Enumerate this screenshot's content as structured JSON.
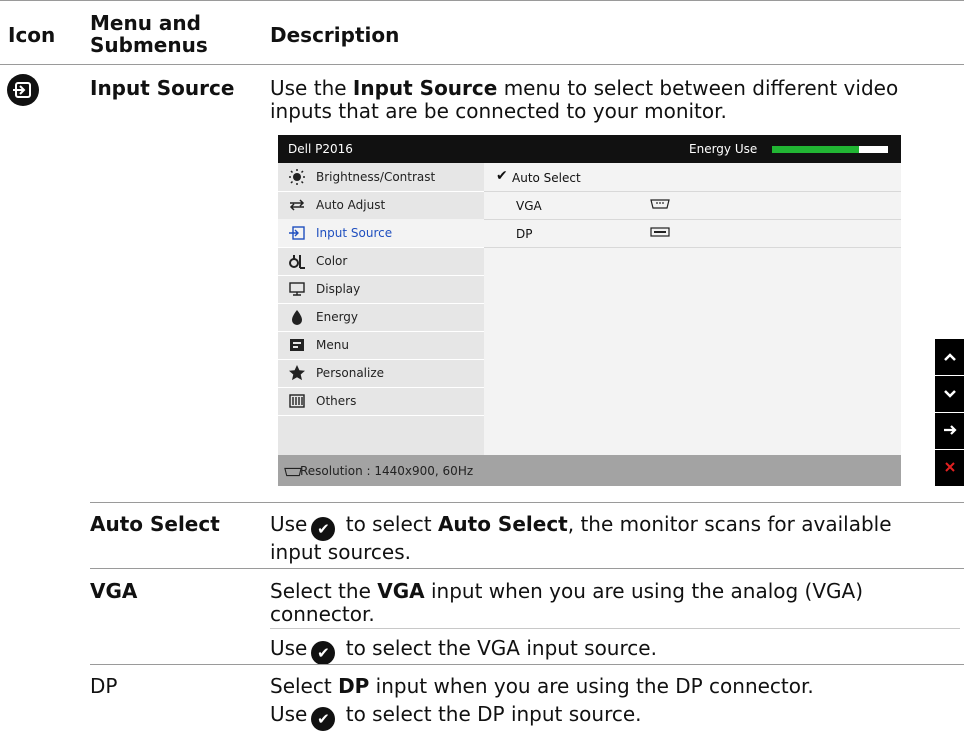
{
  "header": {
    "col_icon": "Icon",
    "col_menu_line1": "Menu and",
    "col_menu_line2": "Submenus",
    "col_desc": "Description"
  },
  "input_source": {
    "name": "Input Source",
    "desc_pre": "Use the ",
    "desc_bold": "Input Source",
    "desc_post": " menu to select between different video",
    "desc_line2": "inputs that are be connected to your monitor."
  },
  "osd": {
    "model": "Dell P2016",
    "energy_label": "Energy Use",
    "energy_level": 0.75,
    "menu_items": [
      {
        "label": "Brightness/Contrast",
        "icon": "brightness-icon"
      },
      {
        "label": "Auto Adjust",
        "icon": "auto-adjust-icon"
      },
      {
        "label": "Input Source",
        "icon": "input-source-icon"
      },
      {
        "label": "Color",
        "icon": "color-icon"
      },
      {
        "label": "Display",
        "icon": "display-icon"
      },
      {
        "label": "Energy",
        "icon": "energy-icon"
      },
      {
        "label": "Menu",
        "icon": "menu-icon"
      },
      {
        "label": "Personalize",
        "icon": "star-icon"
      },
      {
        "label": "Others",
        "icon": "others-icon"
      }
    ],
    "options": [
      {
        "label": "Auto Select"
      },
      {
        "label": "VGA"
      },
      {
        "label": "DP"
      }
    ],
    "resolution": "Resolution : 1440x900, 60Hz"
  },
  "nav_buttons": [
    "up-arrow-icon",
    "down-arrow-icon",
    "right-arrow-icon",
    "close-icon"
  ],
  "rows": {
    "auto_select": {
      "name": "Auto Select",
      "l1_pre": "Use",
      "l1_mid": " to select ",
      "l1_bold": "Auto Select",
      "l1_post": ", the monitor scans for available",
      "l2": "input sources."
    },
    "vga": {
      "name": "VGA",
      "l1_pre": "Select the ",
      "l1_bold": "VGA",
      "l1_post": " input when you are using the analog (VGA)",
      "l2": "connector.",
      "l3_pre": "Use",
      "l3_post": " to select the VGA input source."
    },
    "dp": {
      "name": "DP",
      "l1_pre": "Select ",
      "l1_bold": "DP",
      "l1_post": " input when you are using the DP connector.",
      "l2_pre": "Use",
      "l2_post": " to select the DP input source."
    }
  }
}
